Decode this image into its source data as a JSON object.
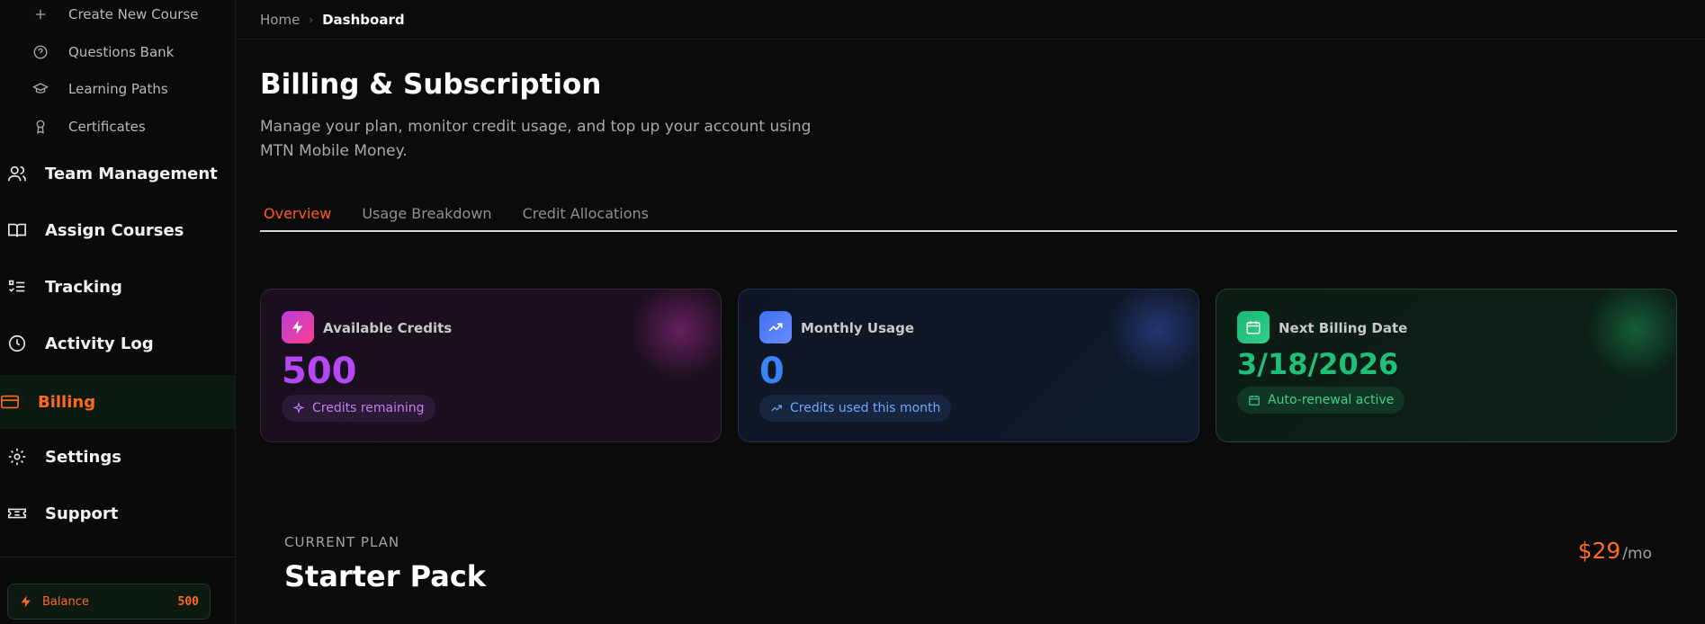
{
  "sidebar": {
    "sub_items": [
      {
        "label": "Create New Course",
        "icon": "plus-icon"
      },
      {
        "label": "Questions Bank",
        "icon": "question-circle-icon"
      },
      {
        "label": "Learning Paths",
        "icon": "graduation-cap-icon"
      },
      {
        "label": "Certificates",
        "icon": "award-icon"
      }
    ],
    "items": [
      {
        "label": "Team Management",
        "icon": "users-icon"
      },
      {
        "label": "Assign Courses",
        "icon": "book-open-icon"
      },
      {
        "label": "Tracking",
        "icon": "list-check-icon"
      },
      {
        "label": "Activity Log",
        "icon": "clock-icon"
      },
      {
        "label": "Billing",
        "icon": "credit-card-icon",
        "active": true
      },
      {
        "label": "Settings",
        "icon": "gear-icon"
      },
      {
        "label": "Support",
        "icon": "ticket-icon"
      }
    ],
    "balance": {
      "label": "Balance",
      "value": "500",
      "icon": "lightning-icon"
    }
  },
  "breadcrumb": {
    "home": "Home",
    "current": "Dashboard"
  },
  "page": {
    "title": "Billing & Subscription",
    "description": "Manage your plan, monitor credit usage, and top up your account using MTN Mobile Money."
  },
  "tabs": [
    {
      "label": "Overview",
      "active": true
    },
    {
      "label": "Usage Breakdown"
    },
    {
      "label": "Credit Allocations"
    }
  ],
  "cards": {
    "credits": {
      "label": "Available Credits",
      "value": "500",
      "pill": "Credits remaining",
      "accent": "#b548f2"
    },
    "usage": {
      "label": "Monthly Usage",
      "value": "0",
      "pill": "Credits used this month",
      "accent": "#3b82f6"
    },
    "billing": {
      "label": "Next Billing Date",
      "value": "3/18/2026",
      "pill": "Auto-renewal active",
      "accent": "#1fbf78"
    }
  },
  "plan": {
    "label": "CURRENT PLAN",
    "name": "Starter Pack",
    "price": "$29",
    "period": "/mo"
  },
  "colors": {
    "accent": "#ff6a1f",
    "background": "#0b0b0b"
  }
}
